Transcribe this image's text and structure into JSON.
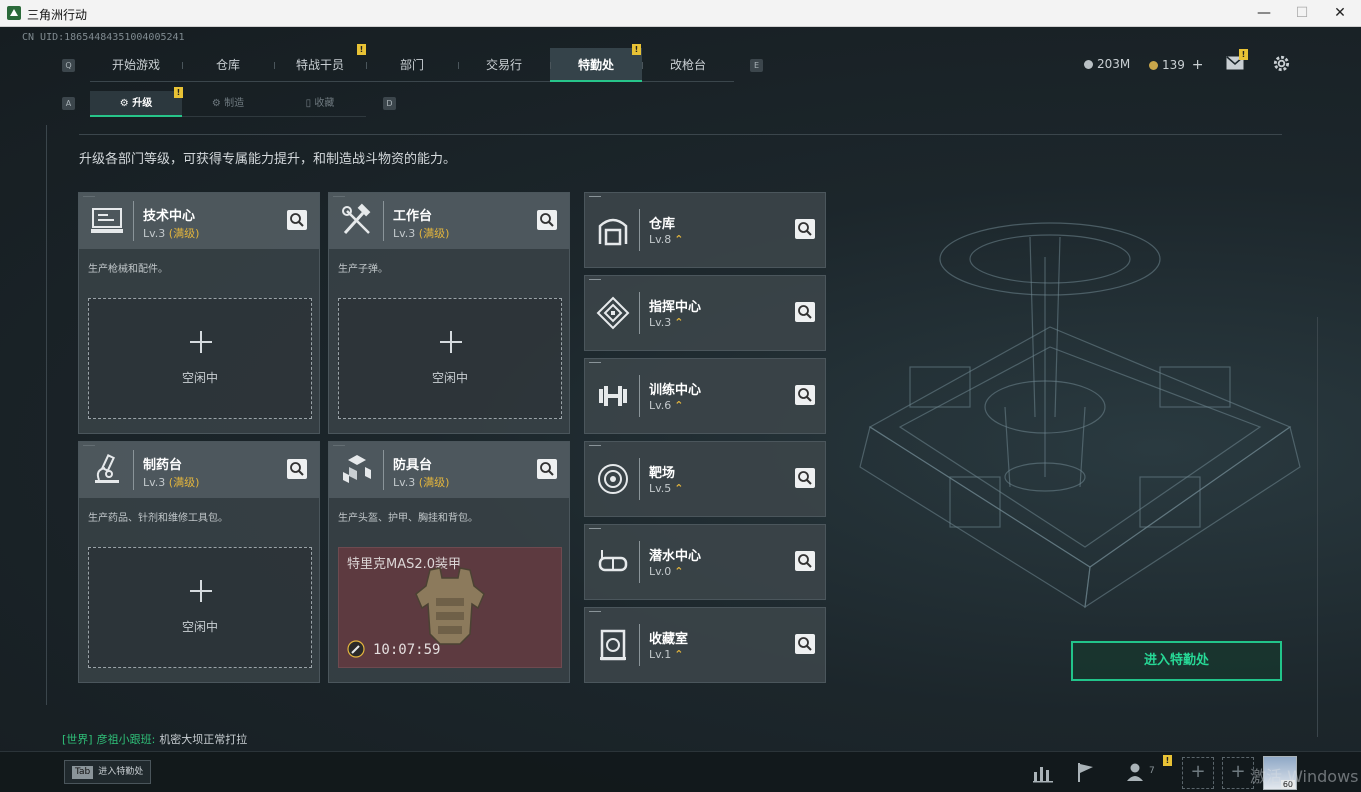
{
  "window": {
    "title": "三角洲行动",
    "minimize": "—",
    "maximize": "☐",
    "close": "✕"
  },
  "uid": "CN UID:18654484351004005241",
  "topnav": {
    "left_key": "Q",
    "right_key": "E",
    "tabs": [
      {
        "label": "开始游戏"
      },
      {
        "label": "仓库"
      },
      {
        "label": "特战干员",
        "badge": "!"
      },
      {
        "label": "部门"
      },
      {
        "label": "交易行"
      },
      {
        "label": "特勤处",
        "active": true,
        "badge": "!"
      },
      {
        "label": "改枪台"
      }
    ]
  },
  "currency": {
    "coins": "203M",
    "premium": "139",
    "add": "+"
  },
  "mail_badge": "!",
  "subnav": {
    "left_key": "A",
    "right_key": "D",
    "tabs": [
      {
        "label": "升级",
        "badge": "!"
      },
      {
        "label": "制造"
      },
      {
        "label": "收藏"
      }
    ]
  },
  "description": "升级各部门等级，可获得专属能力提升，和制造战斗物资的能力。",
  "stations": [
    {
      "name": "技术中心",
      "level": "Lv.3",
      "max": "(满级)",
      "desc": "生产枪械和配件。",
      "icon": "computer-icon",
      "status": "空闲中"
    },
    {
      "name": "工作台",
      "level": "Lv.3",
      "max": "(满级)",
      "desc": "生产子弹。",
      "icon": "tools-icon",
      "status": "空闲中"
    },
    {
      "name": "制药台",
      "level": "Lv.3",
      "max": "(满级)",
      "desc": "生产药品、针剂和维修工具包。",
      "icon": "microscope-icon",
      "status": "空闲中"
    },
    {
      "name": "防具台",
      "level": "Lv.3",
      "max": "(满级)",
      "desc": "生产头盔、护甲、胸挂和背包。",
      "icon": "armor-boxes-icon",
      "crafting": {
        "item": "特里克MAS2.0装甲",
        "timer": "10:07:59"
      }
    }
  ],
  "departments": [
    {
      "name": "仓库",
      "level": "Lv.8",
      "up": "⌃",
      "icon": "warehouse-icon"
    },
    {
      "name": "指挥中心",
      "level": "Lv.3",
      "up": "⌃",
      "icon": "command-center-icon"
    },
    {
      "name": "训练中心",
      "level": "Lv.6",
      "up": "⌃",
      "icon": "dumbbell-icon"
    },
    {
      "name": "靶场",
      "level": "Lv.5",
      "up": "⌃",
      "icon": "target-icon"
    },
    {
      "name": "潜水中心",
      "level": "Lv.0",
      "up": "⌃",
      "icon": "diving-mask-icon"
    },
    {
      "name": "收藏室",
      "level": "Lv.1",
      "up": "⌃",
      "icon": "collection-icon"
    }
  ],
  "enter_button": "进入特勤处",
  "chat": {
    "channel": "[世界]",
    "user": "彦祖小跟班:",
    "message": "机密大坝正常打拉"
  },
  "bottom": {
    "tab_key": "Tab",
    "tab_label": "进入特勤处",
    "friends_count": "7",
    "friends_badge": "!",
    "slot_plus": "+",
    "avatar_level": "60"
  },
  "watermark": "激活 Windows",
  "colors": {
    "accent": "#27c58a",
    "badge": "#e8c235",
    "max_level": "#e3b53d",
    "crafting_bg": "#5d3a40"
  }
}
